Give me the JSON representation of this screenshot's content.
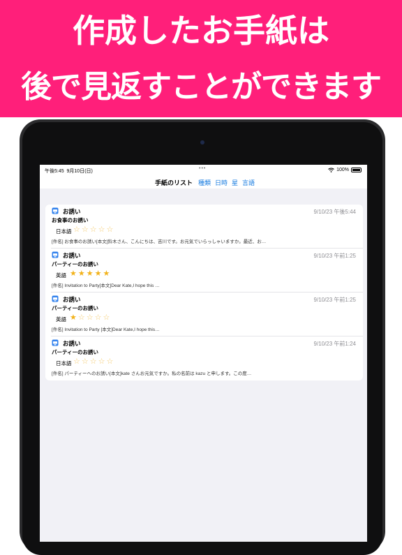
{
  "banner": {
    "line1": "作成したお手紙は",
    "line2": "後で見返すことができます",
    "color": "#ff1f7a"
  },
  "status_bar": {
    "time": "午後5:45",
    "date": "9月10日(日)",
    "dots": "•••",
    "battery": "100%"
  },
  "nav": {
    "title": "手紙のリスト",
    "links": [
      "種類",
      "日時",
      "星",
      "言語"
    ],
    "link_color": "#1a7de0"
  },
  "letters": [
    {
      "category": "お誘い",
      "date": "9/10/23 午後5:44",
      "subject": "お食事のお誘い",
      "language": "日本語",
      "rating": 0,
      "preview": "[件名] お食事のお誘い[本文]鈴木さん、こんにちは、吉川です。お元気でいらっしゃいますか。最近、お…"
    },
    {
      "category": "お誘い",
      "date": "9/10/23 午前1:25",
      "subject": "パーティーのお誘い",
      "language": "英語",
      "rating": 5,
      "preview": "[件名] Invitation to Party[本文]Dear Kate,I hope this …"
    },
    {
      "category": "お誘い",
      "date": "9/10/23 午前1:25",
      "subject": "パーティーのお誘い",
      "language": "英語",
      "rating": 1,
      "preview": "[件名] Invitation to Party [本文]Dear Kate,I hope this…"
    },
    {
      "category": "お誘い",
      "date": "9/10/23 午前1:24",
      "subject": "パーティーのお誘い",
      "language": "日本語",
      "rating": 0,
      "preview": "[件名] パーティーへのお誘い[本文]kate さんお元気ですか。私の名前は kazu と申します。この度…"
    }
  ],
  "icons": {
    "category": "mailbox-icon",
    "star_filled": "★",
    "star_empty": "☆",
    "wifi": "wifi-icon",
    "battery": "battery-icon"
  }
}
